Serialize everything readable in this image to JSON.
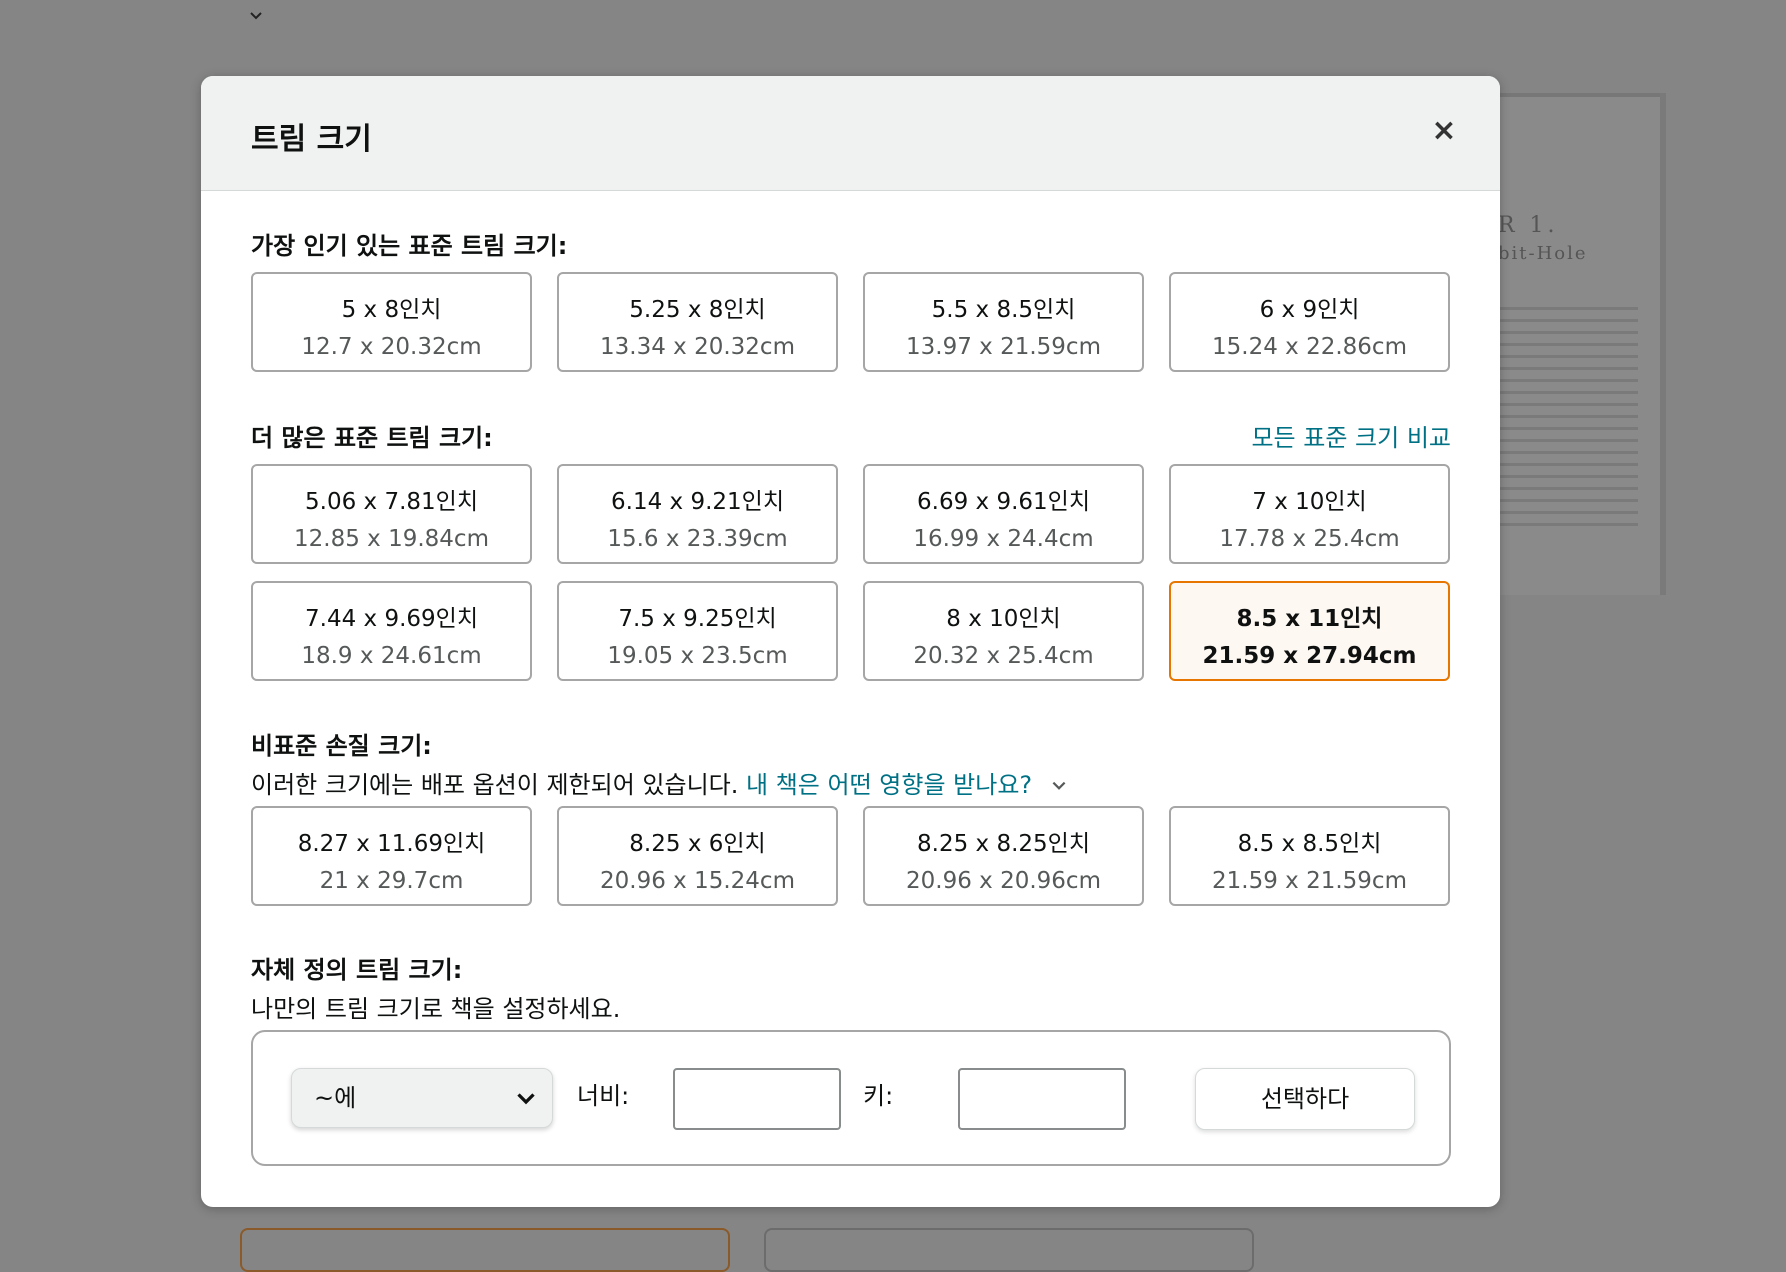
{
  "modal": {
    "title": "트림 크기",
    "close": "×"
  },
  "popular": {
    "title": "가장 인기 있는 표준 트림 크기:",
    "sizes": [
      {
        "in": "5 x 8인치",
        "cm": "12.7 x 20.32cm"
      },
      {
        "in": "5.25 x 8인치",
        "cm": "13.34 x 20.32cm"
      },
      {
        "in": "5.5 x 8.5인치",
        "cm": "13.97 x 21.59cm"
      },
      {
        "in": "6 x 9인치",
        "cm": "15.24 x 22.86cm"
      }
    ]
  },
  "more": {
    "title": "더 많은 표준 트림 크기:",
    "compare_link": "모든 표준 크기 비교",
    "sizes": [
      {
        "in": "5.06 x 7.81인치",
        "cm": "12.85 x 19.84cm"
      },
      {
        "in": "6.14 x 9.21인치",
        "cm": "15.6 x 23.39cm"
      },
      {
        "in": "6.69 x 9.61인치",
        "cm": "16.99 x 24.4cm"
      },
      {
        "in": "7 x 10인치",
        "cm": "17.78 x 25.4cm"
      },
      {
        "in": "7.44 x 9.69인치",
        "cm": "18.9 x 24.61cm"
      },
      {
        "in": "7.5 x 9.25인치",
        "cm": "19.05 x 23.5cm"
      },
      {
        "in": "8 x 10인치",
        "cm": "20.32 x 25.4cm"
      },
      {
        "in": "8.5 x 11인치",
        "cm": "21.59 x 27.94cm",
        "selected": true
      }
    ]
  },
  "nonstandard": {
    "title": "비표준 손질 크기:",
    "desc": "이러한 크기에는 배포 옵션이 제한되어 있습니다.",
    "link": "내 책은 어떤 영향을 받나요?",
    "sizes": [
      {
        "in": "8.27 x 11.69인치",
        "cm": "21 x 29.7cm"
      },
      {
        "in": "8.25 x 6인치",
        "cm": "20.96 x 15.24cm"
      },
      {
        "in": "8.25 x 8.25인치",
        "cm": "20.96 x 20.96cm"
      },
      {
        "in": "8.5 x 8.5인치",
        "cm": "21.59 x 21.59cm"
      }
    ]
  },
  "custom": {
    "title": "자체 정의 트림 크기:",
    "desc": "나만의 트림 크기로 책을 설정하세요.",
    "unit_value": "~에",
    "width_label": "너비:",
    "height_label": "키:",
    "width_value": "",
    "height_value": "",
    "select_label": "선택하다"
  },
  "background": {
    "book_chapter": "R 1.",
    "book_subtitle": "bit-Hole"
  },
  "colors": {
    "accent": "#e77600",
    "link": "#007185",
    "selected_bg": "#fef8f2"
  }
}
